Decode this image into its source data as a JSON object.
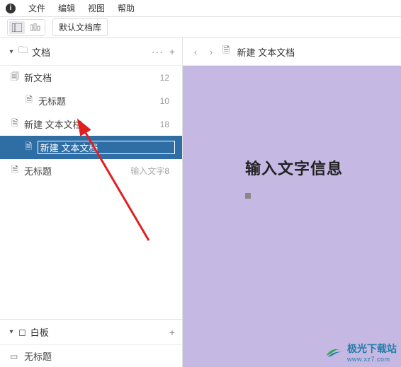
{
  "menu": {
    "file": "文件",
    "edit": "编辑",
    "view": "视图",
    "help": "帮助"
  },
  "toolbar": {
    "defaultLib": "默认文档库"
  },
  "sections": {
    "docs": {
      "title": "文档",
      "dots": "···",
      "plus": "+"
    },
    "boards": {
      "title": "白板",
      "plus": "+"
    }
  },
  "tree": [
    {
      "icon": "doc-group",
      "label": "新文档",
      "count": "12",
      "level": 1
    },
    {
      "icon": "doc",
      "label": "无标题",
      "count": "10",
      "level": 2
    },
    {
      "icon": "doc",
      "label": "新建 文本文档",
      "count": "18",
      "level": 1
    },
    {
      "icon": "doc",
      "label": "新建 文本文档",
      "count": "",
      "level": 2,
      "selected": true,
      "editing": true
    },
    {
      "icon": "doc",
      "label": "无标题",
      "hint": "输入文字",
      "count": "8",
      "level": 1
    }
  ],
  "boardItems": [
    {
      "label": "无标题"
    }
  ],
  "breadcrumb": {
    "title": "新建 文本文档"
  },
  "editor": {
    "title": "输入文字信息"
  },
  "watermark": {
    "cn": "极光下载站",
    "en": "www.xz7.com"
  }
}
